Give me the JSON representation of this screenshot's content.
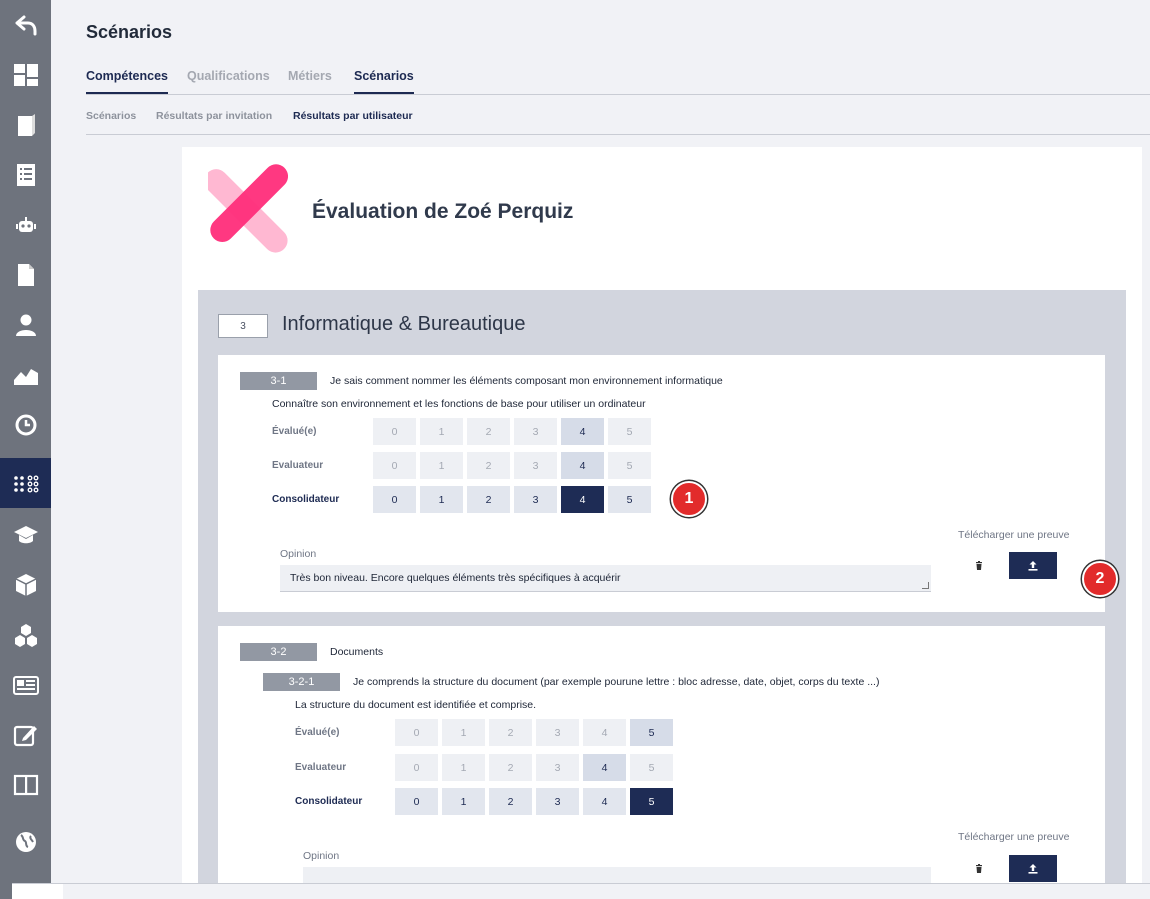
{
  "sidebar": {
    "items": [
      {
        "name": "back-icon"
      },
      {
        "name": "dashboard-icon"
      },
      {
        "name": "book-icon"
      },
      {
        "name": "list-icon"
      },
      {
        "name": "robot-icon"
      },
      {
        "name": "document-icon"
      },
      {
        "name": "user-icon"
      },
      {
        "name": "chart-icon"
      },
      {
        "name": "clock-icon"
      },
      {
        "name": "dots-grid-icon",
        "active": true
      },
      {
        "name": "graduation-cap-icon"
      },
      {
        "name": "cube-icon"
      },
      {
        "name": "cubes-icon"
      },
      {
        "name": "newspaper-icon"
      },
      {
        "name": "edit-icon"
      },
      {
        "name": "columns-icon"
      },
      {
        "name": "globe-icon"
      }
    ]
  },
  "header": {
    "title": "Scénarios",
    "tabs": [
      {
        "label": "Compétences",
        "active": true
      },
      {
        "label": "Qualifications"
      },
      {
        "label": "Métiers"
      },
      {
        "label": "Scénarios",
        "active": true
      }
    ],
    "subtabs": [
      {
        "label": "Scénarios"
      },
      {
        "label": "Résultats par invitation"
      },
      {
        "label": "Résultats par utilisateur",
        "active": true
      }
    ]
  },
  "evaluation": {
    "title": "Évaluation de Zoé Perquiz",
    "section": {
      "number": "3",
      "title": "Informatique & Bureautique",
      "items": [
        {
          "code": "3-1",
          "title": "Je sais comment nommer les éléments composant mon environnement informatique",
          "description": "Connaître son environnement et les fonctions de base pour utiliser un ordinateur",
          "rows": [
            {
              "label": "Évalué(e)",
              "selected": 4
            },
            {
              "label": "Evaluateur",
              "selected": 4
            },
            {
              "label": "Consolidateur",
              "selected": 4
            }
          ],
          "scale": [
            "0",
            "1",
            "2",
            "3",
            "4",
            "5"
          ],
          "opinion_label": "Opinion",
          "opinion_text": "Très bon niveau. Encore quelques éléments très spécifiques à acquérir",
          "upload_label": "Télécharger une preuve",
          "badges": [
            "1",
            "2"
          ]
        },
        {
          "code": "3-2",
          "title": "Documents",
          "subitem": {
            "code": "3-2-1",
            "title": "Je comprends la structure du document (par exemple pourune lettre : bloc adresse, date, objet, corps du texte ...)",
            "description": "La structure du document est identifiée et comprise.",
            "rows": [
              {
                "label": "Évalué(e)",
                "selected": 5
              },
              {
                "label": "Evaluateur",
                "selected": 4
              },
              {
                "label": "Consolidateur",
                "selected": 5
              }
            ],
            "opinion_label": "Opinion",
            "opinion_text": "",
            "upload_label": "Télécharger une preuve"
          }
        }
      ]
    }
  },
  "colors": {
    "sidebar": "#6e737d",
    "sidebar_active": "#1e2c55",
    "accent": "#1e2c55",
    "badge": "#e22b2b",
    "logo_pink": "#ff2d7a",
    "logo_light_pink": "#ffb3cf"
  }
}
